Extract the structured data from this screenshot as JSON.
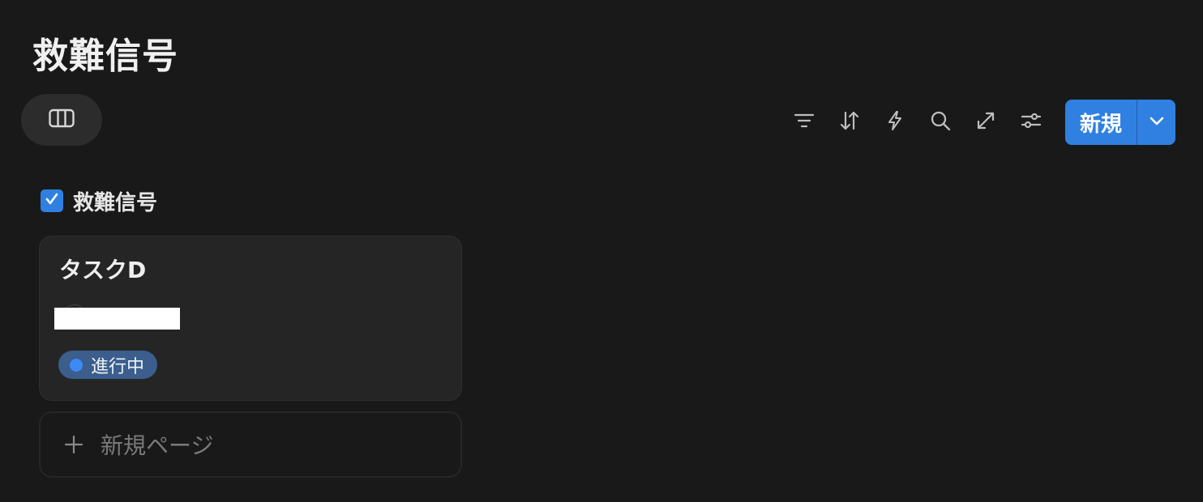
{
  "page": {
    "title": "救難信号"
  },
  "toolbar": {
    "icons": [
      "filter-icon",
      "sort-icon",
      "automation-icon",
      "search-icon",
      "expand-icon",
      "settings-icon"
    ],
    "new_label": "新規"
  },
  "board": {
    "group": {
      "label": "救難信号",
      "checked": true
    },
    "cards": [
      {
        "title": "タスクD",
        "status": "進行中"
      }
    ],
    "new_page_label": "新規ページ"
  },
  "colors": {
    "background": "#191919",
    "accent": "#2f80e0",
    "status_pill": "#3b5e8c",
    "status_dot": "#3d8af7"
  }
}
